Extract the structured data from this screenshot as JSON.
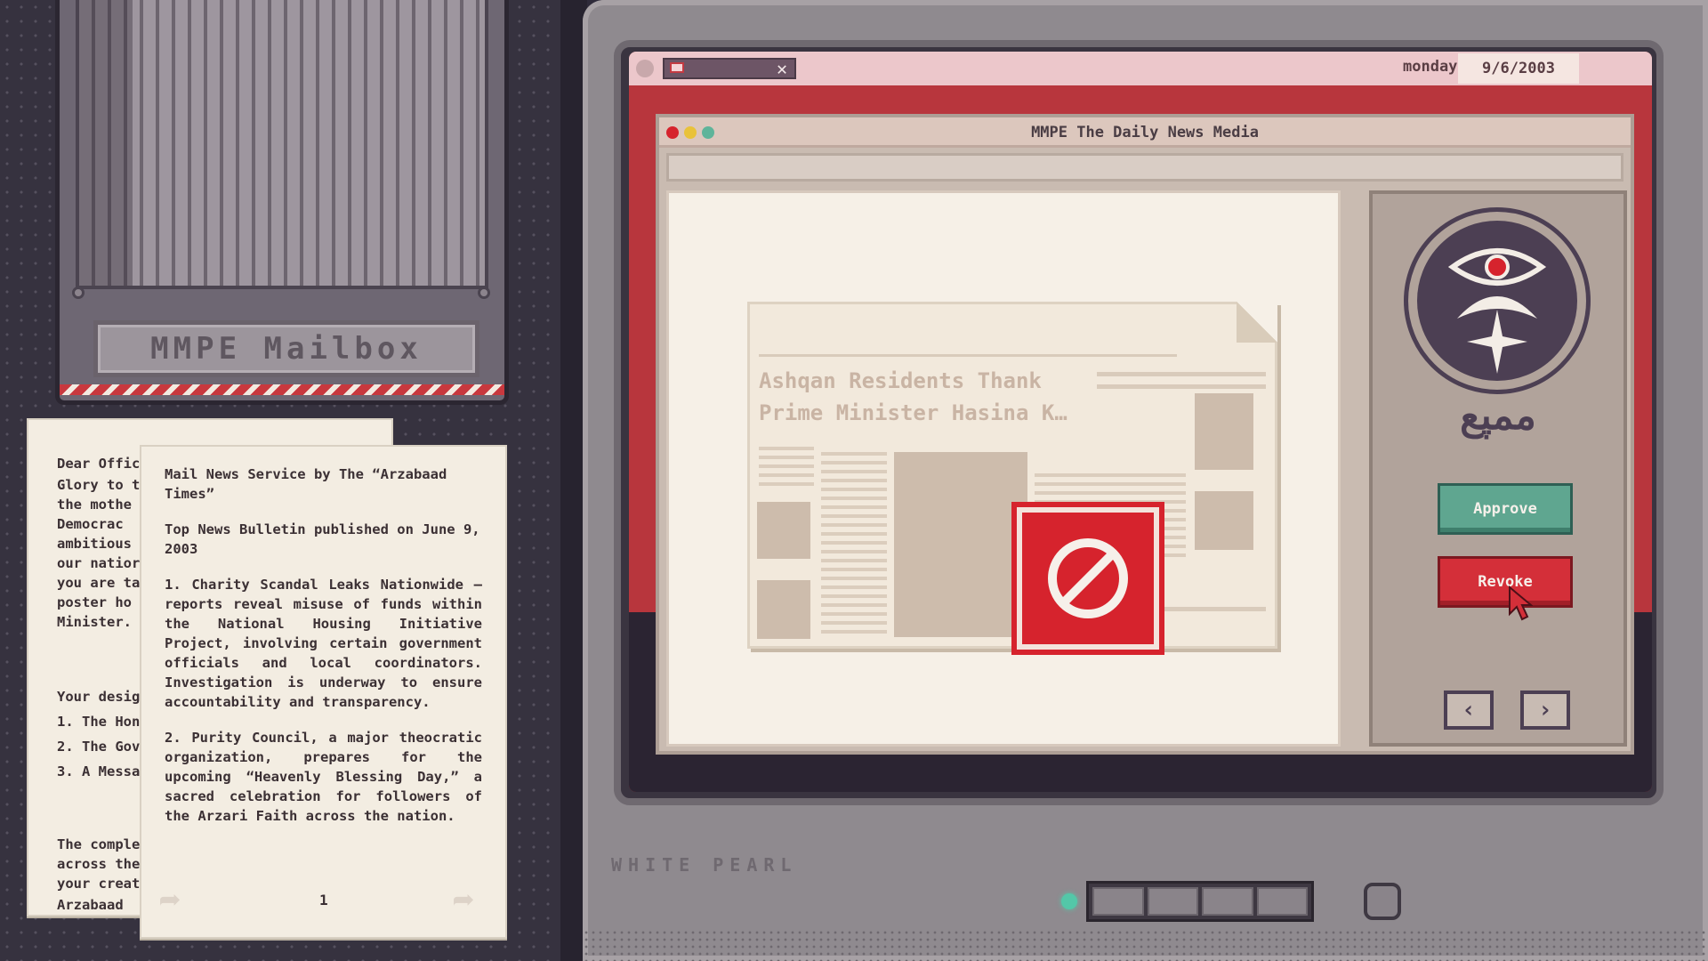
{
  "mailbox": {
    "title": "MMPE Mailbox"
  },
  "letter_back": {
    "lines": [
      "Dear Offic",
      "Glory to tl",
      "the mothe",
      "Democrac",
      "ambitious",
      "our natior",
      "you are ta",
      "poster ho",
      "Minister.",
      "Your desig",
      "1. The Honc",
      "2. The Gove",
      "3. A Messag",
      "The comple",
      "across the",
      "your creat",
      "Arzabaad"
    ]
  },
  "letter_front": {
    "title": "Mail News Service by The “Arzabaad Times”",
    "bulletin": "Top News Bulletin published on June 9, 2003",
    "item1": "1. Charity Scandal Leaks Nationwide — reports reveal misuse of funds within the National Housing Initiative Project, involving certain government officials and local coordinators. Investigation is underway to ensure accountability and transparency.",
    "item2": "2. Purity Council, a major theocratic organization, prepares for the upcoming “Heavenly Blessing Day,” a sacred celebration for followers of the Arzari Faith across the nation.",
    "page": "1"
  },
  "screen": {
    "day": "monday",
    "date": "9/6/2003"
  },
  "app": {
    "title": "MMPE The Daily News Media",
    "news_headline": "Ashqan Residents Thank Prime Minister Hasina K…",
    "brand": "ممپع",
    "approve_label": "Approve",
    "revoke_label": "Revoke",
    "prev_icon": "chevron-left-icon",
    "next_icon": "chevron-right-icon",
    "stamp_icon": "prohibited-icon"
  },
  "monitor": {
    "brand_label": "WHITE PEARL"
  },
  "colors": {
    "approve": "#5fa690",
    "revoke": "#d42f39",
    "stamp": "#d6232d",
    "led": "#53c7a8"
  }
}
